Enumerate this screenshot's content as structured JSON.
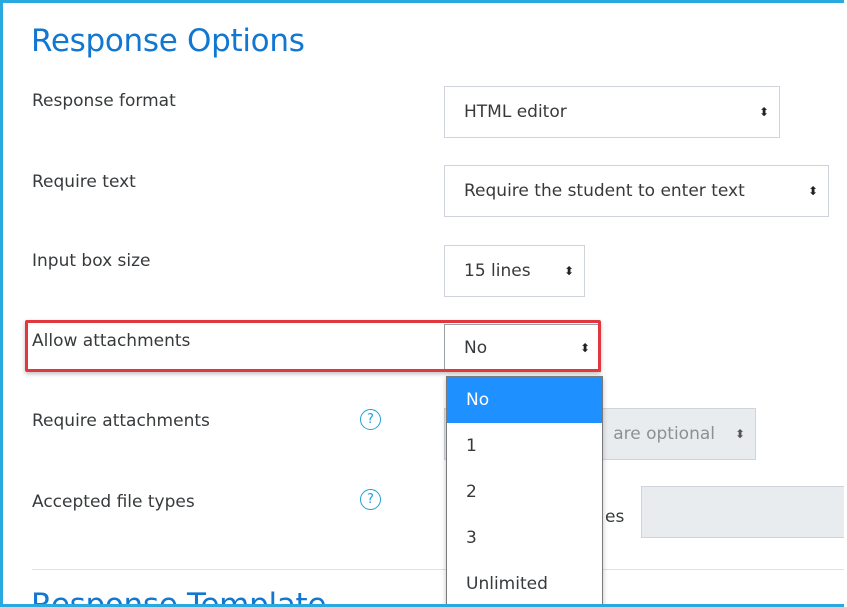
{
  "sections": {
    "response_options_title": "Response Options",
    "response_template_title": "Response Template"
  },
  "fields": {
    "response_format": {
      "label": "Response format",
      "value": "HTML editor"
    },
    "require_text": {
      "label": "Require text",
      "value": "Require the student to enter text"
    },
    "input_box_size": {
      "label": "Input box size",
      "value": "15 lines"
    },
    "allow_attachments": {
      "label": "Allow attachments",
      "value": "No"
    },
    "require_attachments": {
      "label": "Require attachments",
      "value": "are optional"
    },
    "accepted_file_types": {
      "label": "Accepted file types",
      "partial_text": "es"
    }
  },
  "help_glyph": "?",
  "select_arrows": "⬍",
  "dropdown": {
    "options": [
      "No",
      "1",
      "2",
      "3",
      "Unlimited"
    ],
    "selected_index": 0
  },
  "colors": {
    "accent_blue": "#1177d1",
    "frame_blue": "#29a9e0",
    "highlight_red": "#e0383e",
    "selected_option": "#1e90ff"
  }
}
